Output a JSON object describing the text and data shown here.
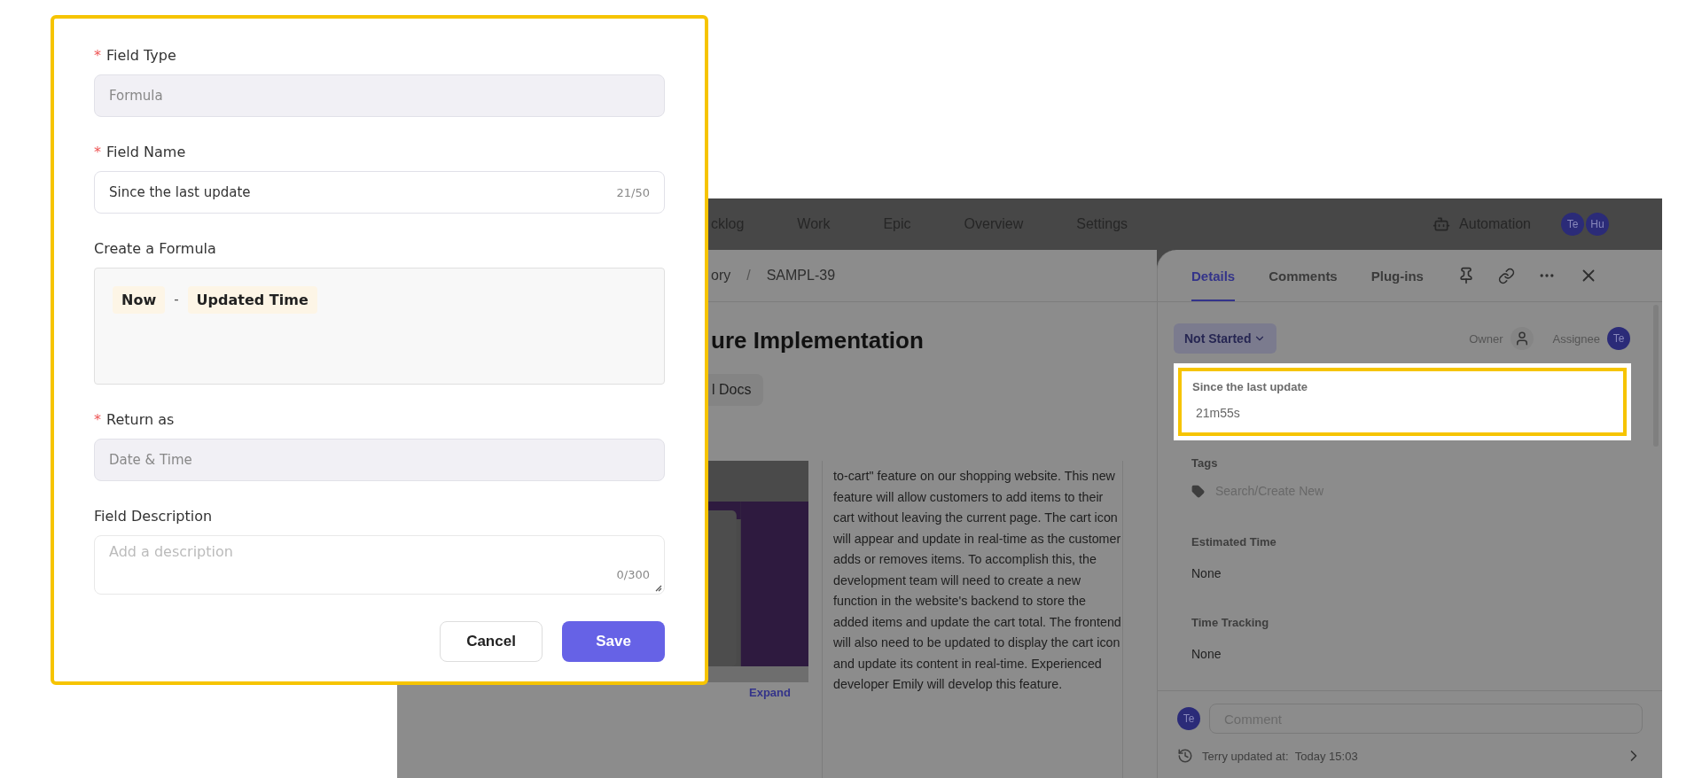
{
  "dialog": {
    "fields": [
      {
        "kind": "text",
        "label": "Field Type",
        "required_mark": "*",
        "disabled": true,
        "value": "Formula"
      },
      {
        "kind": "text",
        "label": "Field Name",
        "required_mark": "*",
        "disabled": false,
        "value": "Since the last update",
        "counter": "21/50"
      },
      {
        "kind": "formula",
        "label": "Create a Formula",
        "tokens": [
          {
            "kind": "token",
            "text": "Now"
          },
          {
            "kind": "operator",
            "text": "-"
          },
          {
            "kind": "token",
            "text": "Updated Time"
          }
        ]
      },
      {
        "kind": "text",
        "label": "Return as",
        "required_mark": "*",
        "disabled": true,
        "value": "Date & Time"
      },
      {
        "kind": "textarea",
        "label": "Field Description",
        "placeholder": "Add a description",
        "counter": "0/300"
      }
    ],
    "buttons": [
      {
        "kind": "secondary",
        "label": "Cancel"
      },
      {
        "kind": "primary",
        "label": "Save"
      }
    ]
  },
  "app": {
    "nav": [
      {
        "label": "cklog",
        "selected": false
      },
      {
        "label": "Work",
        "selected": false
      },
      {
        "label": "Epic",
        "selected": false
      },
      {
        "label": "Overview",
        "selected": false
      },
      {
        "label": "Settings",
        "selected": false
      }
    ],
    "automation": "Automation",
    "avatars": [
      "Te",
      "Hu"
    ],
    "breadcrumb": [
      "ory",
      "SAMPL-39"
    ],
    "breadcrumb_separator": "/",
    "title": "ure Implementation",
    "chip": "l Docs",
    "description": "to-cart\" feature on our shopping website. This new feature will allow customers to add items to their cart without leaving the current page. The cart icon will appear and update in real-time as the customer adds or removes items. To accomplish this, the development team will need to create a new function in the website's backend to store the added items and update the cart total. The frontend will also need to be updated to display the cart icon and update its content in real-time. Experienced developer Emily will develop this feature.",
    "expand": "Expand",
    "panel": {
      "tabs": [
        {
          "label": "Details",
          "selected": true
        },
        {
          "label": "Comments",
          "selected": false
        },
        {
          "label": "Plug-ins",
          "selected": false
        }
      ],
      "status": "Not Started",
      "owner_label": "Owner",
      "assignee_label": "Assignee",
      "assignee": "Te",
      "highlight": {
        "label": "Since the last update",
        "value": "21m55s"
      },
      "tags": {
        "label": "Tags",
        "placeholder": "Search/Create New"
      },
      "fields": [
        {
          "label": "Estimated Time",
          "value": "None"
        },
        {
          "label": "Time Tracking",
          "value": "None"
        }
      ],
      "comment": {
        "avatar": "Te",
        "placeholder": "Comment"
      },
      "footer": {
        "who": "Terry updated at:",
        "when": "Today 15:03"
      }
    }
  }
}
